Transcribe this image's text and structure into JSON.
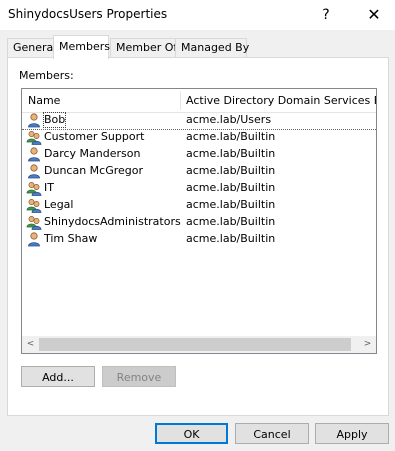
{
  "window": {
    "title": "ShinydocsUsers Properties",
    "help_glyph": "?",
    "close_glyph": "✕"
  },
  "tabs": [
    {
      "label": "General",
      "active": false
    },
    {
      "label": "Members",
      "active": true
    },
    {
      "label": "Member Of",
      "active": false
    },
    {
      "label": "Managed By",
      "active": false
    }
  ],
  "members": {
    "label": "Members:",
    "columns": {
      "name": "Name",
      "folder": "Active Directory Domain Services Folder"
    },
    "rows": [
      {
        "name": "Bob",
        "folder": "acme.lab/Users",
        "kind": "user-icon",
        "selected": true
      },
      {
        "name": "Customer Support",
        "folder": "acme.lab/Builtin",
        "kind": "group-icon"
      },
      {
        "name": "Darcy Manderson",
        "folder": "acme.lab/Builtin",
        "kind": "user-icon"
      },
      {
        "name": "Duncan McGregor",
        "folder": "acme.lab/Builtin",
        "kind": "user-icon"
      },
      {
        "name": "IT",
        "folder": "acme.lab/Builtin",
        "kind": "group-icon"
      },
      {
        "name": "Legal",
        "folder": "acme.lab/Builtin",
        "kind": "group-icon"
      },
      {
        "name": "ShinydocsAdministrators",
        "folder": "acme.lab/Builtin",
        "kind": "group-icon"
      },
      {
        "name": "Tim Shaw",
        "folder": "acme.lab/Builtin",
        "kind": "user-icon"
      }
    ],
    "scroll_left": "<",
    "scroll_right": ">"
  },
  "buttons": {
    "add": "Add...",
    "remove": "Remove",
    "ok": "OK",
    "cancel": "Cancel",
    "apply": "Apply"
  }
}
